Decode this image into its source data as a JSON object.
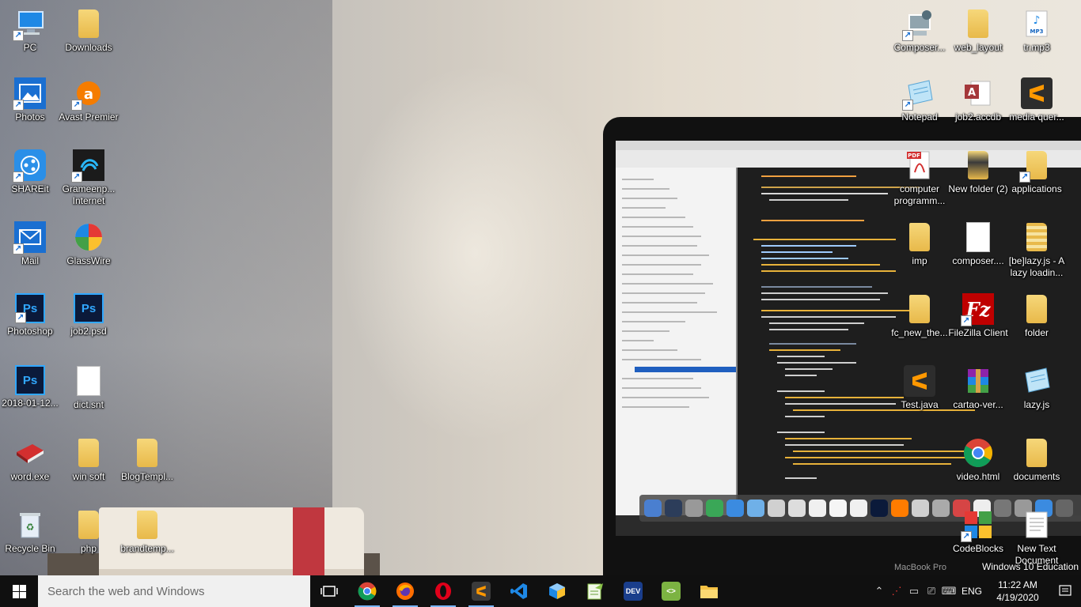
{
  "desktop": {
    "icons_col1": [
      {
        "label": "PC"
      },
      {
        "label": "Photos"
      },
      {
        "label": "SHAREit"
      },
      {
        "label": "Mail"
      },
      {
        "label": "Photoshop"
      },
      {
        "label": "2018-01-12..."
      },
      {
        "label": "word.exe"
      },
      {
        "label": "Recycle Bin"
      }
    ],
    "icons_col2": [
      {
        "label": "Downloads"
      },
      {
        "label": "Avast Premier"
      },
      {
        "label": "Grameenp... Internet"
      },
      {
        "label": "GlassWire"
      },
      {
        "label": "job2.psd"
      },
      {
        "label": "dict.snt"
      },
      {
        "label": "win soft"
      },
      {
        "label": "php"
      }
    ],
    "icons_col3": [
      {
        "label": "BlogTempl..."
      },
      {
        "label": "brandtemp..."
      }
    ],
    "icons_right_col1": [
      {
        "label": "Composer..."
      },
      {
        "label": "Notepad"
      },
      {
        "label": "computer programm..."
      },
      {
        "label": "imp"
      },
      {
        "label": "fc_new_the..."
      },
      {
        "label": "Test.java"
      }
    ],
    "icons_right_col2": [
      {
        "label": "web_layout"
      },
      {
        "label": "job2.accdb"
      },
      {
        "label": "New folder (2)"
      },
      {
        "label": "composer...."
      },
      {
        "label": "FileZilla Client"
      },
      {
        "label": "cartao-ver..."
      },
      {
        "label": "video.html"
      },
      {
        "label": "CodeBlocks"
      }
    ],
    "icons_right_col3": [
      {
        "label": "tr.mp3"
      },
      {
        "label": "media quer..."
      },
      {
        "label": "applications"
      },
      {
        "label": "[be]lazy.js - A lazy loadin..."
      },
      {
        "label": "folder"
      },
      {
        "label": "lazy.js"
      },
      {
        "label": "documents"
      },
      {
        "label": "New Text Document"
      }
    ],
    "watermark": "Windows 10 Education",
    "wallpaper_laptop_label": "MacBook Pro"
  },
  "taskbar": {
    "search_placeholder": "Search the web and Windows",
    "language": "ENG",
    "time": "11:22 AM",
    "date": "4/19/2020"
  }
}
